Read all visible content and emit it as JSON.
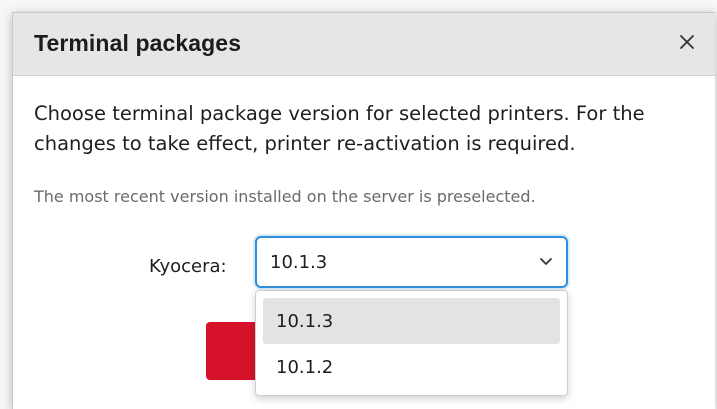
{
  "dialog": {
    "title": "Terminal packages",
    "close_icon": "close-icon",
    "description": "Choose terminal package version for selected printers. For the changes to take effect, printer re-activation is required.",
    "hint": "The most recent version installed on the server is preselected."
  },
  "field": {
    "label": "Kyocera:",
    "selected_value": "10.1.3",
    "chevron_icon": "chevron-down-icon",
    "options": [
      {
        "label": "10.1.3",
        "highlighted": true
      },
      {
        "label": "10.1.2",
        "highlighted": false
      }
    ]
  },
  "colors": {
    "accent_border": "#2f8fdc",
    "primary_button": "#d6122b",
    "header_background": "#e6e6e6"
  }
}
